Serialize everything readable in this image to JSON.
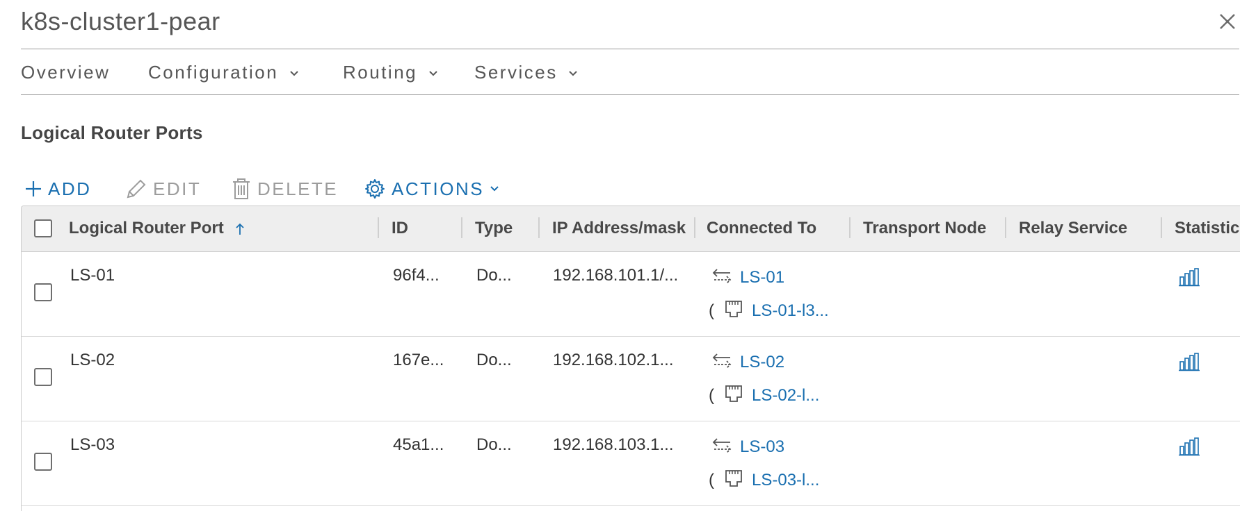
{
  "dialog": {
    "title": "k8s-cluster1-pear",
    "close_icon": "close-icon"
  },
  "nav": {
    "overview": "Overview",
    "configuration": "Configuration",
    "routing": "Routing",
    "services": "Services"
  },
  "section": {
    "title": "Logical Router Ports"
  },
  "toolbar": {
    "add": "ADD",
    "edit": "EDIT",
    "delete": "DELETE",
    "actions": "ACTIONS"
  },
  "colors": {
    "link": "#1a6fb0",
    "disabled": "#9c9c9c",
    "header_bg": "#eeeeee"
  },
  "table": {
    "columns": [
      "Logical Router Port",
      "ID",
      "Type",
      "IP Address/mask",
      "Connected To",
      "Transport Node",
      "Relay Service",
      "Statistic"
    ],
    "sort_icon": "sort-ascending-icon",
    "rows": [
      {
        "port": "LS-01",
        "id": "96f4...",
        "type": "Do...",
        "ip": "192.168.101.1/...",
        "connected_switch": "LS-01",
        "connected_port_prefix": "(",
        "connected_port": "LS-01-l3...",
        "stats_icon": "bar-chart-icon"
      },
      {
        "port": "LS-02",
        "id": "167e...",
        "type": "Do...",
        "ip": "192.168.102.1...",
        "connected_switch": "LS-02",
        "connected_port_prefix": "(",
        "connected_port": "LS-02-l...",
        "stats_icon": "bar-chart-icon"
      },
      {
        "port": "LS-03",
        "id": "45a1...",
        "type": "Do...",
        "ip": "192.168.103.1...",
        "connected_switch": "LS-03",
        "connected_port_prefix": "(",
        "connected_port": "LS-03-l...",
        "stats_icon": "bar-chart-icon"
      }
    ]
  }
}
